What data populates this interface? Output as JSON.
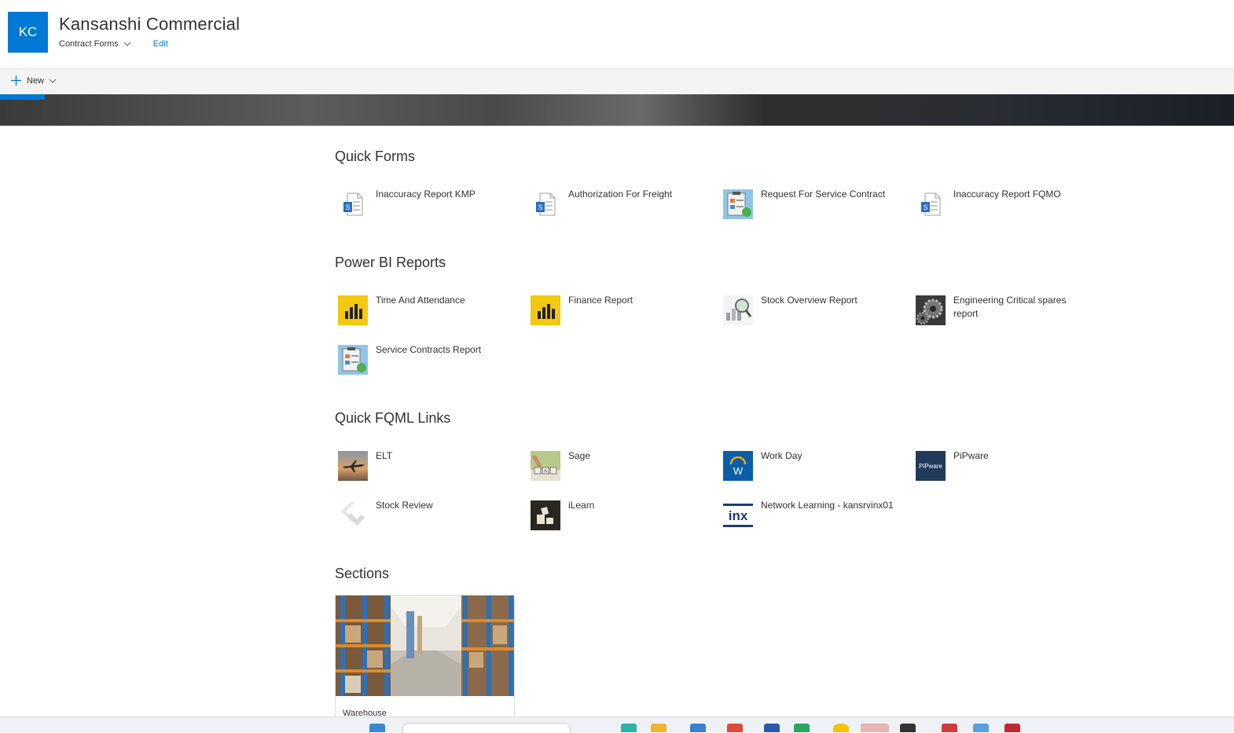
{
  "site": {
    "logo_initials": "KC",
    "title": "Kansanshi Commercial",
    "nav_label": "Contract Forms",
    "edit_label": "Edit"
  },
  "command_bar": {
    "new_label": "New"
  },
  "sections": {
    "quick_forms": {
      "title": "Quick Forms",
      "items": [
        {
          "label": "Inaccuracy Report KMP",
          "icon": "sharepoint-form-icon"
        },
        {
          "label": "Authorization For Freight",
          "icon": "sharepoint-form-icon"
        },
        {
          "label": "Request For Service Contract",
          "icon": "clipboard-image-icon"
        },
        {
          "label": "Inaccuracy Report FQMO",
          "icon": "sharepoint-form-icon"
        }
      ]
    },
    "power_bi": {
      "title": "Power BI Reports",
      "items": [
        {
          "label": "Time And Attendance",
          "icon": "power-bi-icon"
        },
        {
          "label": "Finance Report",
          "icon": "power-bi-icon"
        },
        {
          "label": "Stock Overview Report",
          "icon": "magnifier-chart-icon"
        },
        {
          "label": "Engineering Critical spares report",
          "icon": "gears-icon"
        },
        {
          "label": "Service Contracts Report",
          "icon": "clipboard-image-icon"
        }
      ]
    },
    "fqml_links": {
      "title": "Quick FQML Links",
      "items": [
        {
          "label": "ELT",
          "icon": "airplane-icon"
        },
        {
          "label": "Sage",
          "icon": "dice-icon"
        },
        {
          "label": "Work Day",
          "icon": "workday-icon"
        },
        {
          "label": "PiPware",
          "icon": "pipware-icon",
          "logo_text": "PiPware"
        },
        {
          "label": "Stock Review",
          "icon": "chevron-logo-icon"
        },
        {
          "label": "iLearn",
          "icon": "ilearn-icon"
        },
        {
          "label": "Network Learning - kansrvinx01",
          "icon": "inx-icon",
          "logo_text": "inx"
        }
      ]
    },
    "sections": {
      "title": "Sections",
      "cards": [
        {
          "label": "Warehouse"
        }
      ]
    }
  },
  "colors": {
    "accent": "#0078d4",
    "text": "#323130"
  }
}
